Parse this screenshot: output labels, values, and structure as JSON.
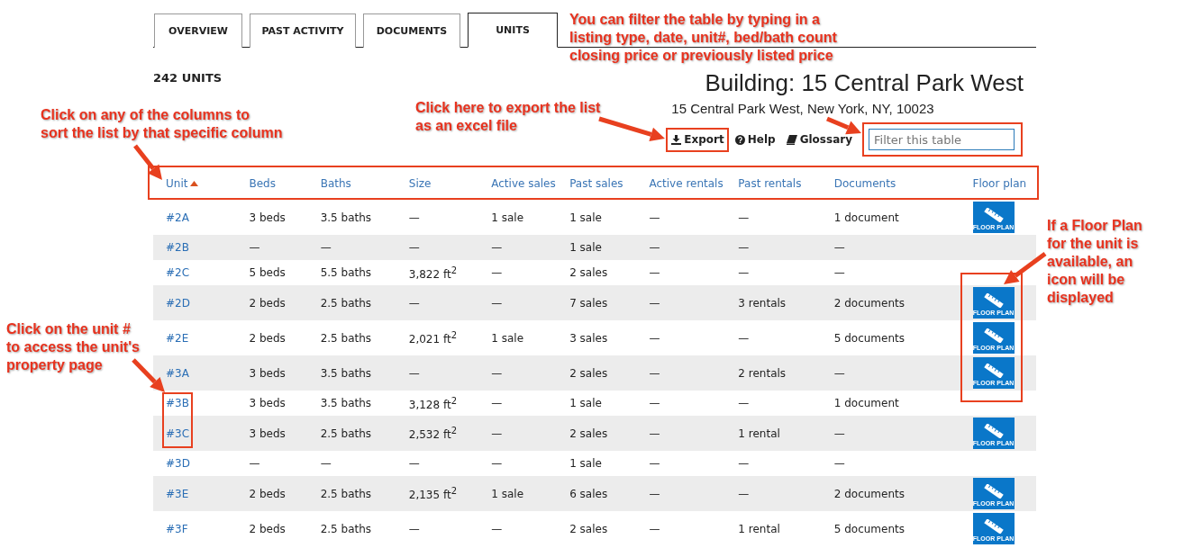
{
  "tabs": [
    {
      "label": "OVERVIEW",
      "selected": false
    },
    {
      "label": "PAST ACTIVITY",
      "selected": false
    },
    {
      "label": "DOCUMENTS",
      "selected": false
    },
    {
      "label": "UNITS",
      "selected": true
    }
  ],
  "unit_count": "242 UNITS",
  "building": {
    "title": "Building: 15 Central Park West",
    "address": "15 Central Park West, New York, NY, 10023"
  },
  "toolbar": {
    "export": "Export",
    "help": "Help",
    "glossary": "Glossary",
    "filter_placeholder": "Filter this table"
  },
  "table": {
    "columns": [
      {
        "label": "Unit",
        "sorted": true
      },
      {
        "label": "Beds",
        "sorted": false
      },
      {
        "label": "Baths",
        "sorted": false
      },
      {
        "label": "Size",
        "sorted": false
      },
      {
        "label": "Active sales",
        "sorted": false
      },
      {
        "label": "Past sales",
        "sorted": false
      },
      {
        "label": "Active rentals",
        "sorted": false
      },
      {
        "label": "Past rentals",
        "sorted": false
      },
      {
        "label": "Documents",
        "sorted": false
      },
      {
        "label": "Floor plan",
        "sorted": false
      }
    ],
    "rows": [
      {
        "cells": [
          "#2A",
          "3 beds",
          "3.5 baths",
          "—",
          "1 sale",
          "1 sale",
          "—",
          "—",
          "1 document"
        ],
        "floor_plan": "FLOOR PLAN"
      },
      {
        "cells": [
          "#2B",
          "—",
          "—",
          "—",
          "—",
          "1 sale",
          "—",
          "—",
          "—"
        ]
      },
      {
        "cells": [
          "#2C",
          "5 beds",
          "5.5 baths",
          "3,822 ft$^{2}$",
          "—",
          "2 sales",
          "—",
          "—",
          "—"
        ]
      },
      {
        "cells": [
          "#2D",
          "2 beds",
          "2.5 baths",
          "—",
          "—",
          "7 sales",
          "—",
          "3 rentals",
          "2 documents"
        ],
        "floor_plan": "FLOOR PLAN"
      },
      {
        "cells": [
          "#2E",
          "2 beds",
          "2.5 baths",
          "2,021 ft$^{2}$",
          "1 sale",
          "3 sales",
          "—",
          "—",
          "5 documents"
        ],
        "floor_plan": "FLOOR PLAN"
      },
      {
        "cells": [
          "#3A",
          "3 beds",
          "3.5 baths",
          "—",
          "—",
          "2 sales",
          "—",
          "2 rentals",
          "—"
        ],
        "floor_plan": "FLOOR PLAN"
      },
      {
        "cells": [
          "#3B",
          "3 beds",
          "3.5 baths",
          "3,128 ft$^{2}$",
          "—",
          "1 sale",
          "—",
          "—",
          "1 document"
        ]
      },
      {
        "cells": [
          "#3C",
          "3 beds",
          "2.5 baths",
          "2,532 ft$^{2}$",
          "—",
          "2 sales",
          "—",
          "1 rental",
          "—"
        ],
        "floor_plan": "FLOOR PLAN"
      },
      {
        "cells": [
          "#3D",
          "—",
          "—",
          "—",
          "—",
          "1 sale",
          "—",
          "—",
          "—"
        ]
      },
      {
        "cells": [
          "#3E",
          "2 beds",
          "2.5 baths",
          "2,135 ft$^{2}$",
          "1 sale",
          "6 sales",
          "—",
          "—",
          "2 documents"
        ],
        "floor_plan": "FLOOR PLAN"
      },
      {
        "cells": [
          "#3F",
          "2 beds",
          "2.5 baths",
          "—",
          "—",
          "2 sales",
          "—",
          "1 rental",
          "5 documents"
        ],
        "floor_plan": "FLOOR PLAN"
      }
    ]
  },
  "annotations": [
    "You can filter the table by typing in a\nlisting type, date, unit#, bed/bath count\nclosing price or previously listed price",
    "Click here to export the list\nas an excel file",
    "Click on any of the columns to\nsort the list by that specific column",
    "Click on the unit #\nto access the unit's\nproperty page",
    "If a Floor Plan\nfor the unit is\navailable, an\nicon will be\ndisplayed"
  ]
}
